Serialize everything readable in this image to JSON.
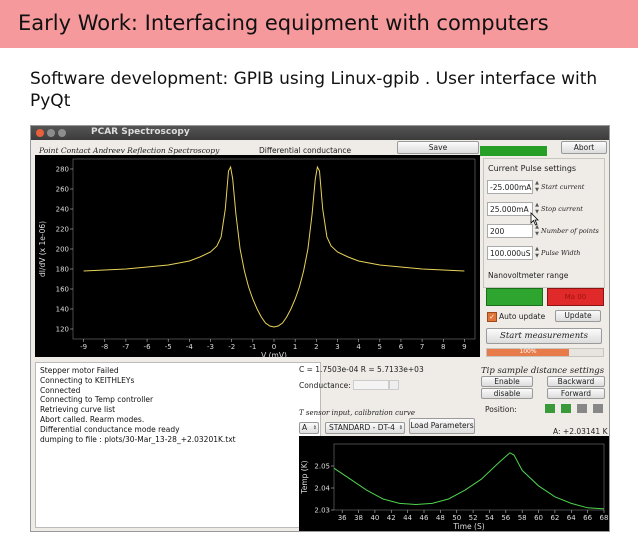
{
  "slide": {
    "title": "Early Work: Interfacing equipment with computers",
    "body": "Software development: GPIB using Linux-gpib . User interface with PyQt"
  },
  "window": {
    "title": "PCAR Spectroscopy",
    "header_italic": "Point Contact Andreev Reflection Spectroscopy",
    "plot_title": "Differential conductance",
    "save_label": "Save",
    "abort_label": "Abort"
  },
  "pulse": {
    "section_label": "Current Pulse settings",
    "start_current": "-25.000mA",
    "start_label": "Start current",
    "stop_current": "25.000mA",
    "stop_label": "Stop current",
    "points": "200",
    "points_label": "Number of points",
    "pulse_width": "100.000uS",
    "pulse_width_label": "Pulse Width",
    "nanovolt_label": "Nanovoltmeter range",
    "red_btn": "Ma 00",
    "auto_update_label": "Auto update",
    "update_label": "Update",
    "start_meas_label": "Start measurements",
    "progress_text": "100%",
    "progress": 1.0
  },
  "fit": {
    "cr_text": "C = 1.7503e-04  R = 5.7133e+03",
    "conductance_label": "Conductance:"
  },
  "tip": {
    "section_label": "Tip sample distance settings",
    "enable": "Enable",
    "backward": "Backward",
    "disable": "disable",
    "forward": "Forward",
    "position_label": "Position:",
    "position_colors": [
      "#3a9a3a",
      "#3a9a3a",
      "#888888",
      "#888888"
    ]
  },
  "tsensor": {
    "label": "T sensor input, calibration curve",
    "channel": "A",
    "curve": "STANDARD - DT-4",
    "load_label": "Load Parameters",
    "temp_readout": "A: +2.03141 K"
  },
  "log": [
    "Stepper motor Failed",
    "Connecting to KEITHLEYs",
    "Connected",
    "Connecting to Temp controller",
    "Retrieving curve list",
    "Abort called.  Rearm modes.",
    "Differential conductance mode ready",
    "dumping to file : plots/30-Mar_13-28_+2.03201K.txt"
  ],
  "chart_data": [
    {
      "type": "line",
      "xlabel": "V (mV)",
      "ylabel": "dI/dV (x 1e-06)",
      "xlim": [
        -9.5,
        9.5
      ],
      "ylim": [
        110,
        290
      ],
      "xticks": [
        -9,
        -8,
        -7,
        -6,
        -5,
        -4,
        -3,
        -2,
        -1,
        0,
        1,
        2,
        3,
        4,
        5,
        6,
        7,
        8,
        9
      ],
      "yticks": [
        120,
        140,
        160,
        180,
        200,
        220,
        240,
        260,
        280
      ],
      "color": "#e8d35a",
      "x": [
        -9.0,
        -8.0,
        -7.0,
        -6.0,
        -5.0,
        -4.0,
        -3.5,
        -3.0,
        -2.7,
        -2.5,
        -2.3,
        -2.15,
        -2.05,
        -1.95,
        -1.8,
        -1.6,
        -1.4,
        -1.2,
        -1.0,
        -0.8,
        -0.6,
        -0.4,
        -0.2,
        0.0,
        0.2,
        0.4,
        0.6,
        0.8,
        1.0,
        1.2,
        1.4,
        1.6,
        1.8,
        1.95,
        2.05,
        2.15,
        2.3,
        2.5,
        2.7,
        3.0,
        3.5,
        4.0,
        5.0,
        6.0,
        7.0,
        8.0,
        9.0
      ],
      "y": [
        178,
        179,
        180,
        182,
        184,
        188,
        192,
        197,
        203,
        212,
        240,
        278,
        282,
        270,
        235,
        200,
        178,
        162,
        150,
        140,
        132,
        126,
        123,
        122,
        123,
        126,
        132,
        140,
        150,
        162,
        178,
        200,
        235,
        270,
        282,
        278,
        240,
        212,
        203,
        197,
        192,
        188,
        184,
        182,
        180,
        179,
        178
      ]
    },
    {
      "type": "line",
      "xlabel": "Time (S)",
      "ylabel": "Temp (K)",
      "xlim": [
        35,
        68
      ],
      "ylim": [
        2.03,
        2.06
      ],
      "xticks": [
        36,
        38,
        40,
        42,
        44,
        46,
        48,
        50,
        52,
        54,
        56,
        58,
        60,
        62,
        64,
        66,
        68
      ],
      "yticks": [
        2.03,
        2.04,
        2.05
      ],
      "color": "#4fd34f",
      "x": [
        35,
        37,
        39,
        41,
        43,
        45,
        47,
        49,
        51,
        53,
        55,
        56.5,
        57,
        58,
        60,
        62,
        64,
        66,
        68
      ],
      "y": [
        2.049,
        2.044,
        2.039,
        2.035,
        2.033,
        2.0325,
        2.033,
        2.035,
        2.039,
        2.044,
        2.051,
        2.056,
        2.055,
        2.048,
        2.041,
        2.036,
        2.033,
        2.031,
        2.0305
      ]
    }
  ]
}
